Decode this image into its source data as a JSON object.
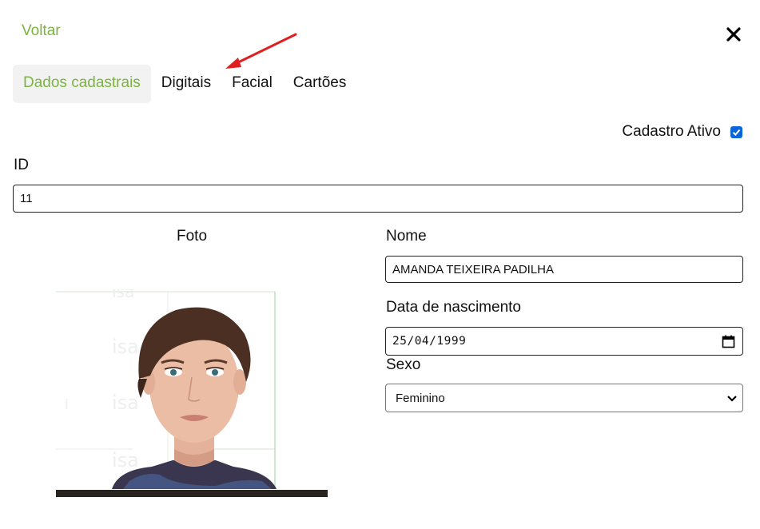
{
  "header": {
    "back_label": "Voltar",
    "close_icon": "close-icon"
  },
  "tabs": [
    {
      "label": "Dados cadastrais",
      "active": true
    },
    {
      "label": "Digitais",
      "active": false
    },
    {
      "label": "Facial",
      "active": false
    },
    {
      "label": "Cartões",
      "active": false
    }
  ],
  "form": {
    "active_label": "Cadastro Ativo",
    "active_checked": true,
    "id_label": "ID",
    "id_value": "11",
    "photo_label": "Foto",
    "name_label": "Nome",
    "name_value": "AMANDA TEIXEIRA PADILHA",
    "birth_label": "Data de nascimento",
    "birth_value": "25/04/1999",
    "sex_label": "Sexo",
    "sex_value": "Feminino"
  },
  "colors": {
    "accent": "#7cb342",
    "checkbox": "#0a66d8",
    "arrow": "#e02020"
  }
}
